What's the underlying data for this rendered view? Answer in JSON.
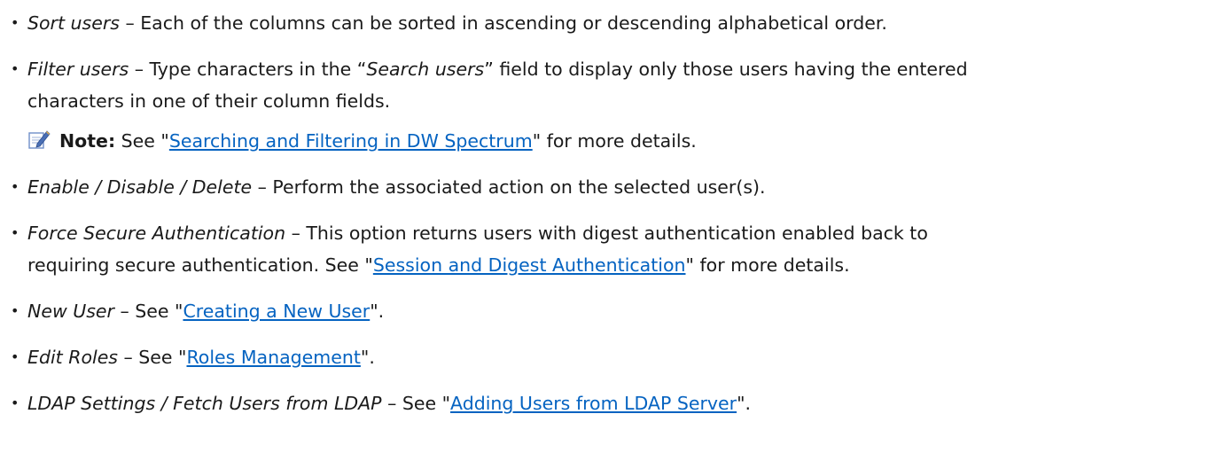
{
  "items": [
    {
      "term": "Sort users",
      "dash": " – ",
      "text": "Each of the columns can be sorted in ascending or descending alphabetical order."
    },
    {
      "term": "Filter users",
      "dash": " – ",
      "text_a": "Type characters in the “",
      "inline_term": "Search users",
      "text_b": "” field to display only those users having the entered",
      "text_line2": "characters in one of their column fields."
    },
    {
      "note_label": "Note:",
      "note_pre": " See \"",
      "note_link": "Searching and Filtering in DW Spectrum",
      "note_post": "\" for more details."
    },
    {
      "term": "Enable / Disable / Delete",
      "dash": " – ",
      "text": "Perform the associated action on the selected user(s)."
    },
    {
      "term": "Force Secure Authentication",
      "dash": " – ",
      "text": "This option returns users with digest authentication enabled back to",
      "line2_pre": "requiring secure authentication. See \"",
      "line2_link": "Session and Digest Authentication",
      "line2_post": "\" for more details."
    },
    {
      "term": "New User",
      "dash": " – ",
      "pre": "See \"",
      "link": "Creating a New User",
      "post": "\"."
    },
    {
      "term": "Edit Roles",
      "dash": " – ",
      "pre": "See \"",
      "link": "Roles Management",
      "post": "\"."
    },
    {
      "term": "LDAP Settings / Fetch Users from LDAP",
      "dash": " – ",
      "pre": "See \"",
      "link": "Adding Users from LDAP Server",
      "post": "\"."
    }
  ],
  "bullet_char": "•",
  "colors": {
    "link": "#0563c1",
    "text": "#1a1a1a",
    "note_icon": "#4a6fb5"
  },
  "icons": {
    "note": "note-pencil-icon"
  }
}
